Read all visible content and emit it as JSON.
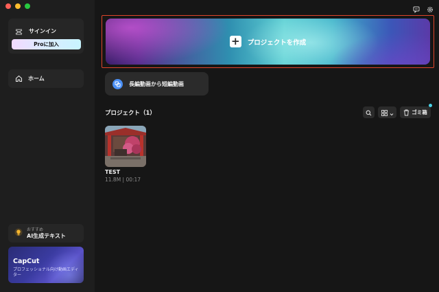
{
  "window": {
    "controls": [
      "close",
      "minimize",
      "maximize"
    ]
  },
  "sidebar": {
    "signin": {
      "label": "サインイン",
      "icon": "capcut-logo-icon"
    },
    "pro_button": {
      "label": "Proに加入"
    },
    "nav": [
      {
        "label": "ホーム",
        "icon": "home-icon"
      }
    ],
    "ai_card": {
      "small": "おすすめ",
      "title": "AI生成テキスト",
      "icon": "lightbulb-icon"
    },
    "capcut_card": {
      "title": "CapCut",
      "subtitle": "プロフェッショナル向け動画エディター"
    }
  },
  "topbar": {
    "icons": [
      "feedback-icon",
      "settings-icon"
    ]
  },
  "main": {
    "create_button": {
      "label": "プロジェクトを作成",
      "icon": "plus-icon"
    },
    "convert_button": {
      "label": "長編動画から短編動画",
      "icon": "clip-convert-icon"
    },
    "projects": {
      "title": "プロジェクト（1）",
      "toolbar": {
        "trash_label": "ゴミ箱"
      },
      "items": [
        {
          "name": "TEST",
          "meta": "11.8M | 00:17"
        }
      ]
    }
  },
  "colors": {
    "background": "#161616",
    "sidebar": "#1e1e1e",
    "highlight_outline": "#e0452b",
    "accent_blue": "#4a8ff5"
  }
}
